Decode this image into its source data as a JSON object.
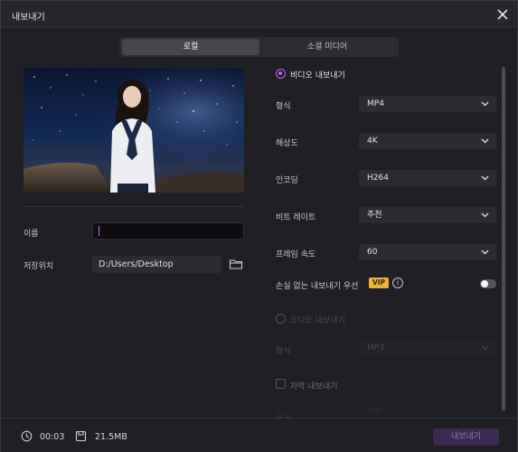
{
  "window": {
    "title": "내보내기"
  },
  "tabs": [
    {
      "label": "로컬",
      "active": true
    },
    {
      "label": "소셜 미디어",
      "active": false
    }
  ],
  "left": {
    "name_label": "이름",
    "name_value": "",
    "location_label": "저장위치",
    "location_value": "D:/Users/Desktop"
  },
  "video": {
    "section_label": "비디오 내보내기",
    "rows": [
      {
        "label": "형식",
        "value": "MP4"
      },
      {
        "label": "해상도",
        "value": "4K"
      },
      {
        "label": "인코딩",
        "value": "H264"
      },
      {
        "label": "비트 레이트",
        "value": "추천"
      },
      {
        "label": "프레임 속도",
        "value": "60"
      }
    ],
    "lossless_label": "손실 없는 내보내기 우선",
    "vip_badge": "VIP",
    "info_glyph": "i",
    "lossless_on": false
  },
  "audio": {
    "section_label": "오디오 내보내기",
    "format_label": "형식",
    "format_value": "MP3"
  },
  "subtitle": {
    "section_label": "자막 내보내기",
    "format_label": "형식",
    "format_value": "SRT"
  },
  "footer": {
    "duration": "00:03",
    "size": "21.5MB",
    "export_label": "내보내기"
  },
  "colors": {
    "accent": "#b46cf0",
    "vip": "#e9b23a",
    "export_bg": "#3b2a52"
  }
}
